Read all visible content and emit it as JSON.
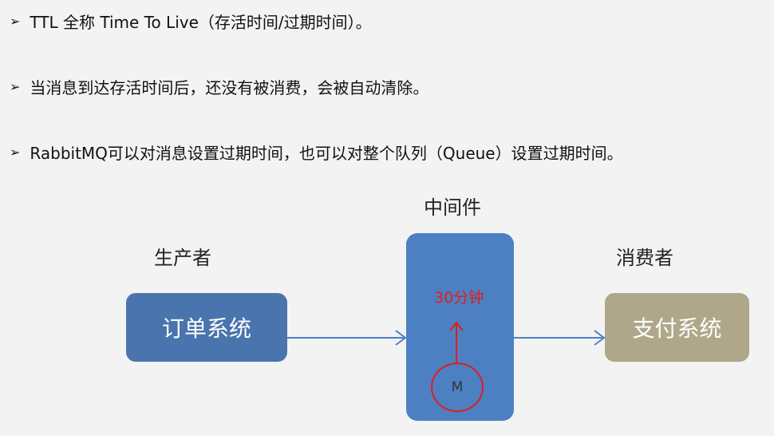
{
  "bullets": [
    "TTL 全称 Time To Live（存活时间/过期时间）。",
    "当消息到达存活时间后，还没有被消费，会被自动清除。",
    "RabbitMQ可以对消息设置过期时间，也可以对整个队列（Queue）设置过期时间。"
  ],
  "diagram": {
    "middleware_label": "中间件",
    "producer_label": "生产者",
    "consumer_label": "消费者",
    "producer_box": "订单系统",
    "consumer_box": "支付系统",
    "ttl_label": "30分钟",
    "message_label": "M"
  },
  "colors": {
    "producer_box": "#4a74ad",
    "middleware_box": "#4c80c2",
    "consumer_box": "#aea789",
    "ttl_red": "#e01d1d",
    "arrow": "#4c80c2"
  }
}
